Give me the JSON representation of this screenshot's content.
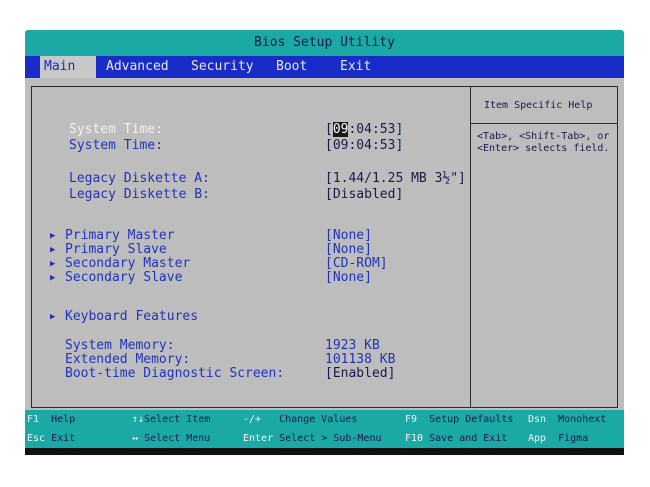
{
  "title": "Bios Setup Utility",
  "menu": {
    "main": "Main",
    "advanced": "Advanced",
    "security": "Security",
    "boot": "Boot",
    "exit": "Exit"
  },
  "help": {
    "title": "Item Specific Help",
    "line1": "<Tab>, <Shift-Tab>, or",
    "line2": "<Enter> selects field."
  },
  "fields": {
    "time1_label": "System Time:",
    "time1_hour": "09",
    "time1_rest": ":04:53]",
    "time2_label": "System Time:",
    "time2_value": "[09:04:53]",
    "diskA_label": "Legacy Diskette A:",
    "diskA_value": "[1.44/1.25 MB 3½\"]",
    "diskB_label": "Legacy Diskette B:",
    "diskB_value": "[Disabled]",
    "pm_label": "Primary Master",
    "pm_value": "[None]",
    "ps_label": "Primary Slave",
    "ps_value": "[None]",
    "sm_label": "Secondary Master",
    "sm_value": "[CD-ROM]",
    "ss_label": "Secondary Slave",
    "ss_value": "[None]",
    "kb_label": "Keyboard Features",
    "sysmem_label": "System Memory:",
    "sysmem_value": "1923 KB",
    "extmem_label": "Extended Memory:",
    "extmem_value": "101138 KB",
    "diag_label": "Boot-time Diagnostic Screen:",
    "diag_value": "[Enabled]"
  },
  "footer": {
    "f1_key": "F1",
    "f1_desc": "Help",
    "esc_key": "Esc",
    "esc_desc": "Exit",
    "ud_key": "↑↓",
    "ud_desc": "Select Item",
    "lr_key": "↔",
    "lr_desc": "Select Menu",
    "pm_key": "-/+",
    "pm_desc": "Change Values",
    "enter_key": "Enter",
    "enter_desc": "Select > Sub-Menu",
    "f9_key": "F9",
    "f9_desc": "Setup Defaults",
    "f10_key": "F10",
    "f10_desc": "Save and Exit",
    "dsn_key": "Dsn",
    "dsn_desc": "Monohext",
    "app_key": "App",
    "app_desc": "Figma"
  },
  "colors": {
    "teal": "#1aa9a5",
    "menu_blue": "#1a2cc8",
    "content_gray": "#bdbdbd",
    "label_blue": "#2233bb"
  }
}
